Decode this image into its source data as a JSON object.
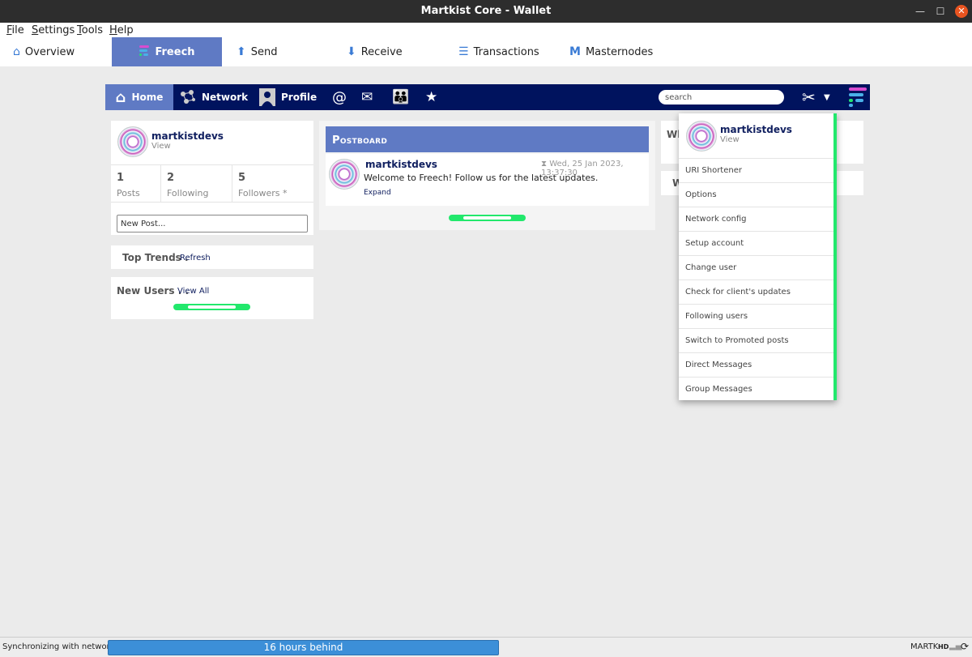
{
  "window": {
    "title": "Martkist Core - Wallet"
  },
  "menu": [
    "File",
    "Settings",
    "Tools",
    "Help"
  ],
  "tabs": [
    {
      "label": "Overview",
      "icon": "home-icon"
    },
    {
      "label": "Freech",
      "icon": "freech-logo-icon",
      "active": true
    },
    {
      "label": "Send",
      "icon": "arrow-up-icon"
    },
    {
      "label": "Receive",
      "icon": "arrow-down-icon"
    },
    {
      "label": "Transactions",
      "icon": "list-icon"
    },
    {
      "label": "Masternodes",
      "icon": "masternode-icon"
    }
  ],
  "nav": {
    "home": "Home",
    "network": "Network",
    "profile": "Profile",
    "search_placeholder": "search"
  },
  "profile": {
    "username": "martkistdevs",
    "view": "View",
    "stats": [
      {
        "value": "1",
        "label": "Posts"
      },
      {
        "value": "2",
        "label": "Following"
      },
      {
        "value": "5",
        "label": "Followers *"
      }
    ],
    "new_post_placeholder": "New Post..."
  },
  "trends": {
    "title": "Top Trends .",
    "refresh": "Refresh"
  },
  "new_users": {
    "title": "New Users . .",
    "view_all": "View All"
  },
  "postboard": {
    "title": "Postboard",
    "post": {
      "author": "martkistdevs",
      "time": "Wed, 25 Jan 2023, 13:37:30",
      "text": "Welcome to Freech! Follow us for the latest updates.",
      "expand": "Expand"
    }
  },
  "right_cards": {
    "card1_letters": "Wh",
    "card2_letters": "W"
  },
  "dropdown": {
    "username": "martkistdevs",
    "view": "View",
    "items": [
      "URI Shortener",
      "Options",
      "Network config",
      "Setup account",
      "Change user",
      "Check for client's updates",
      "Following users",
      "Switch to Promoted posts",
      "Direct Messages",
      "Group Messages"
    ]
  },
  "status": {
    "sync_text": "Synchronizing with network...",
    "progress_text": "16 hours behind",
    "unit": "MARTK",
    "hd": "HD"
  },
  "colors": {
    "accent": "#5f7ac4",
    "navy": "#00135e",
    "green": "#22e86c",
    "progress": "#3c8fd8"
  }
}
